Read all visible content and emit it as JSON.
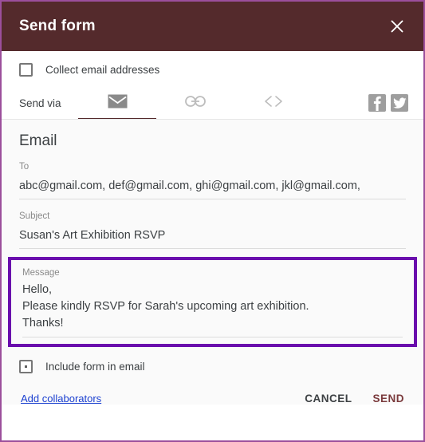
{
  "dialog": {
    "title": "Send form",
    "close_icon": "close-icon",
    "border_color": "#9c4f9c",
    "header_color": "#542a2c"
  },
  "collect": {
    "label": "Collect email addresses",
    "checked": false
  },
  "send_via": {
    "label": "Send via",
    "tabs": [
      {
        "name": "email",
        "icon": "envelope-icon",
        "active": true
      },
      {
        "name": "link",
        "icon": "link-icon",
        "active": false
      },
      {
        "name": "embed",
        "icon": "code-icon",
        "active": false
      }
    ],
    "social": [
      {
        "name": "facebook",
        "icon": "facebook-icon",
        "glyph": "f"
      },
      {
        "name": "twitter",
        "icon": "twitter-icon",
        "glyph": "bird"
      }
    ]
  },
  "email": {
    "section_title": "Email",
    "to_label": "To",
    "to_value": "abc@gmail.com, def@gmail.com, ghi@gmail.com, jkl@gmail.com,",
    "subject_label": "Subject",
    "subject_value": "Susan's Art Exhibition RSVP",
    "message_label": "Message",
    "message_lines": [
      "Hello,",
      "Please kindly RSVP for Sarah's upcoming art exhibition.",
      "Thanks!"
    ],
    "message_highlight_color": "#6a0dad"
  },
  "include_form": {
    "label": "Include form in email",
    "checked": "partial"
  },
  "footer": {
    "collaborators_link": "Add collaborators",
    "cancel_label": "CANCEL",
    "send_label": "SEND",
    "send_color": "#7a3a3c",
    "link_color": "#1a3fd0"
  }
}
